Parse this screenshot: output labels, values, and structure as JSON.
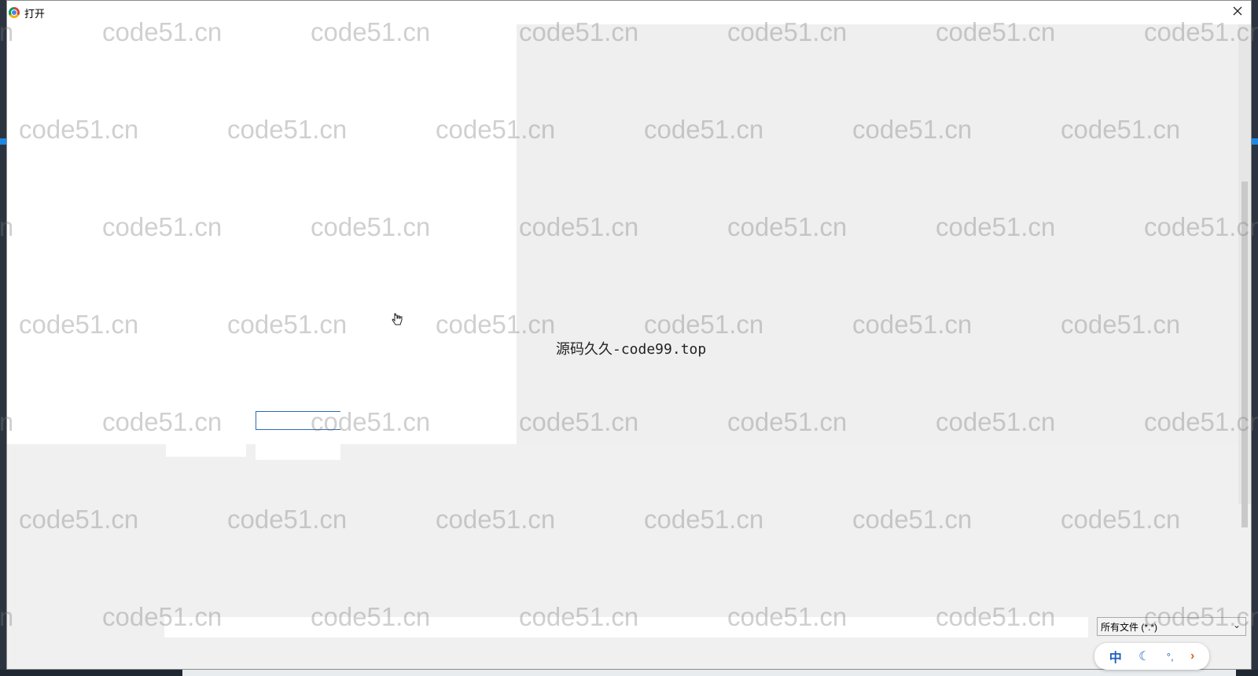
{
  "dialog": {
    "title": "打开",
    "close_icon": "close-icon"
  },
  "center_caption": "源码久久-code99.top",
  "rename_input_value": "",
  "file_type": {
    "selected": "所有文件 (*.*)"
  },
  "ime_toolbar": {
    "lang": "中",
    "mode_icon": "moon-icon",
    "punct": "°,",
    "arrow": "›"
  },
  "watermark": "code51.cn"
}
